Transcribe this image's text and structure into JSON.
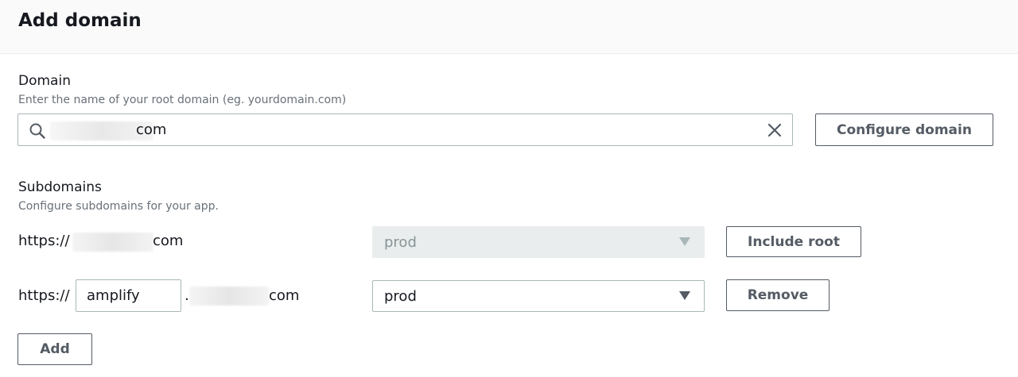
{
  "header": {
    "title": "Add domain"
  },
  "domain": {
    "label": "Domain",
    "description": "Enter the name of your root domain (eg. yourdomain.com)",
    "input_value_suffix": "com",
    "configure_button": "Configure domain"
  },
  "subdomains": {
    "label": "Subdomains",
    "description": "Configure subdomains for your app.",
    "rows": [
      {
        "prefix": "https://",
        "suffix": "com",
        "branch": "prod",
        "action": "Include root"
      },
      {
        "prefix": "https://",
        "subdomain_value": "amplify",
        "dot": ".",
        "suffix": "com",
        "branch": "prod",
        "action": "Remove"
      }
    ],
    "add_button": "Add"
  },
  "icons": {
    "search": "search-icon",
    "clear": "close-icon",
    "caret": "caret-down-icon"
  },
  "colors": {
    "text": "#16191f",
    "muted": "#687078",
    "button_border": "#545b64",
    "disabled_bg": "#eaeded"
  }
}
